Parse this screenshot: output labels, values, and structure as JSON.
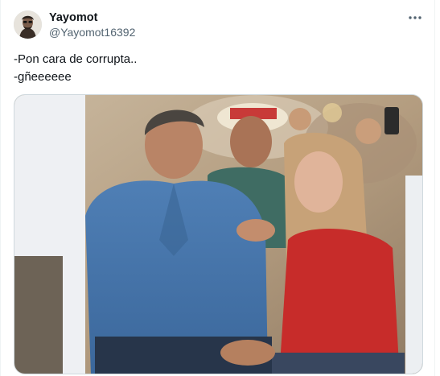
{
  "tweet": {
    "author": {
      "name": "Yayomot",
      "handle": "@Yayomot16392",
      "avatar_icon": "user-avatar"
    },
    "more_icon": "more-horizontal-icon",
    "text_lines": [
      "-Pon cara de corrupta..",
      "-gñeeeeee"
    ],
    "media": {
      "kind": "photo",
      "description": "Photo of people seated at an outdoor event"
    }
  },
  "colors": {
    "text_primary": "#0f1419",
    "text_secondary": "#536471",
    "border": "#cfd9de"
  }
}
